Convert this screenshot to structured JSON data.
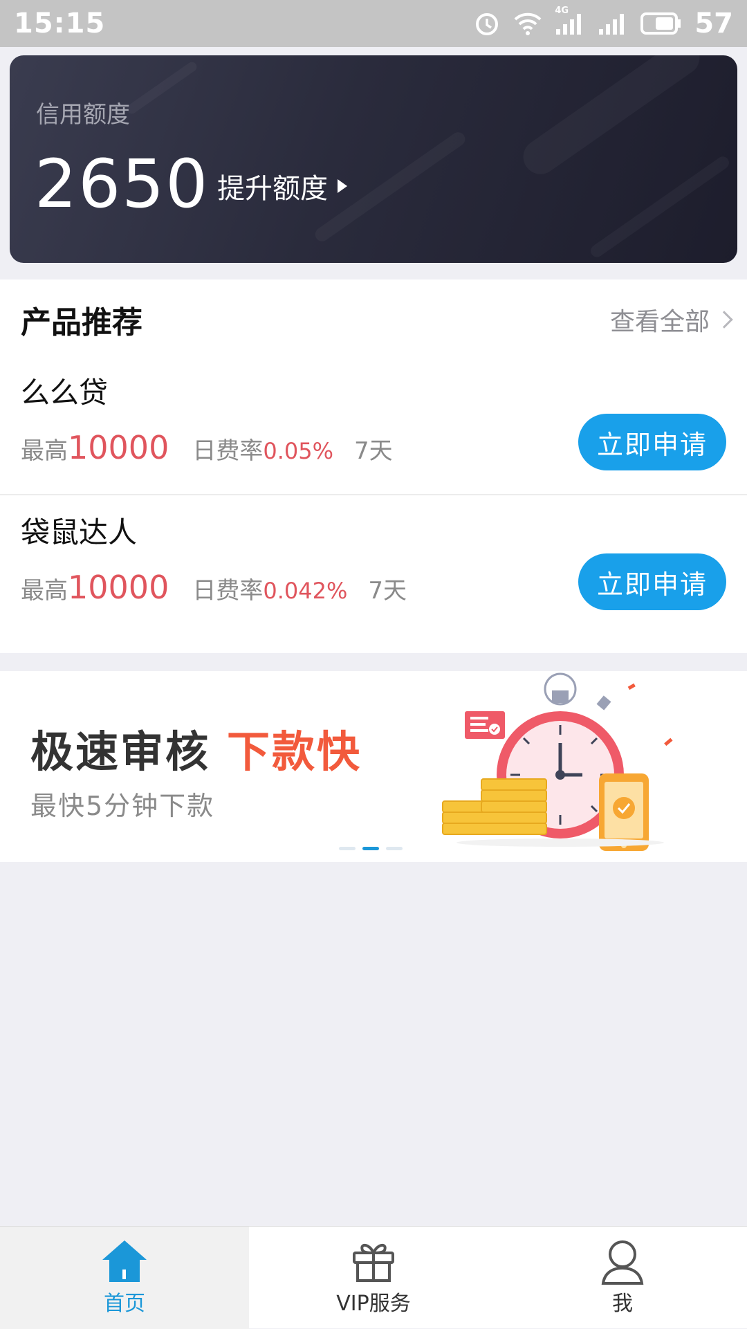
{
  "status_bar": {
    "time": "15:15",
    "network": "4G",
    "battery": "57"
  },
  "credit_card": {
    "label": "信用额度",
    "amount": "2650",
    "raise_label": "提升额度"
  },
  "products": {
    "title": "产品推荐",
    "view_all": "查看全部",
    "items": [
      {
        "name": "么么贷",
        "max_label": "最高",
        "max_value": "10000",
        "rate_label": "日费率",
        "rate_value": "0.05%",
        "term": "7天",
        "apply_label": "立即申请"
      },
      {
        "name": "袋鼠达人",
        "max_label": "最高",
        "max_value": "10000",
        "rate_label": "日费率",
        "rate_value": "0.042%",
        "term": "7天",
        "apply_label": "立即申请"
      }
    ]
  },
  "banner": {
    "headline": "极速审核",
    "headline_accent": "下款快",
    "subtitle": "最快5分钟下款",
    "active_dot": 1
  },
  "tabbar": {
    "items": [
      {
        "label": "首页",
        "icon": "home-icon",
        "active": true
      },
      {
        "label": "VIP服务",
        "icon": "gift-icon",
        "active": false
      },
      {
        "label": "我",
        "icon": "user-icon",
        "active": false
      }
    ]
  },
  "colors": {
    "accent": "#19a0ea",
    "highlight": "#e0555d",
    "banner_accent": "#f25a3c",
    "card_dark": "#2a2b3c"
  }
}
